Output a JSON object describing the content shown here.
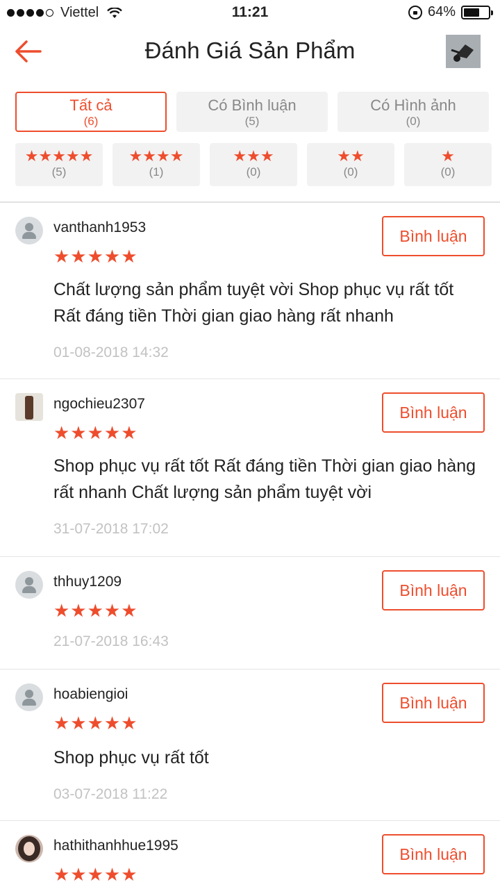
{
  "status_bar": {
    "carrier": "Viettel",
    "time": "11:21",
    "battery": "64%",
    "battery_level": 0.64
  },
  "header": {
    "title": "Đánh Giá Sản Phẩm",
    "back_icon": "back-arrow-icon",
    "accent": "#ee4d2d"
  },
  "filters": {
    "tabs": [
      {
        "label": "Tất cả",
        "count": "(6)",
        "active": true
      },
      {
        "label": "Có Bình luận",
        "count": "(5)",
        "active": false
      },
      {
        "label": "Có Hình ảnh",
        "count": "(0)",
        "active": false
      }
    ],
    "star_filters": [
      {
        "stars": "★★★★★",
        "count": "(5)"
      },
      {
        "stars": "★★★★",
        "count": "(1)"
      },
      {
        "stars": "★★★",
        "count": "(0)"
      },
      {
        "stars": "★★",
        "count": "(0)"
      },
      {
        "stars": "★",
        "count": "(0)"
      }
    ]
  },
  "reviews": [
    {
      "username": "vanthanh1953",
      "rating": 5,
      "stars": "★★★★★",
      "comment": "Chất lượng sản phẩm tuyệt vời Shop phục vụ rất tốt Rất đáng tiền Thời gian giao hàng rất nhanh",
      "date": "01-08-2018 14:32",
      "reply_label": "Bình luận"
    },
    {
      "username": "ngochieu2307",
      "rating": 5,
      "stars": "★★★★★",
      "comment": "Shop phục vụ rất tốt Rất đáng tiền Thời gian giao hàng rất nhanh Chất lượng sản phẩm tuyệt vời",
      "date": "31-07-2018 17:02",
      "reply_label": "Bình luận"
    },
    {
      "username": "thhuy1209",
      "rating": 5,
      "stars": "★★★★★",
      "comment": "",
      "date": "21-07-2018 16:43",
      "reply_label": "Bình luận"
    },
    {
      "username": "hoabiengioi",
      "rating": 5,
      "stars": "★★★★★",
      "comment": "Shop phục vụ rất tốt",
      "date": "03-07-2018 11:22",
      "reply_label": "Bình luận"
    },
    {
      "username": "hathithanhhue1995",
      "rating": 5,
      "stars": "★★★★★",
      "comment": "",
      "date": "",
      "reply_label": "Bình luận"
    }
  ]
}
